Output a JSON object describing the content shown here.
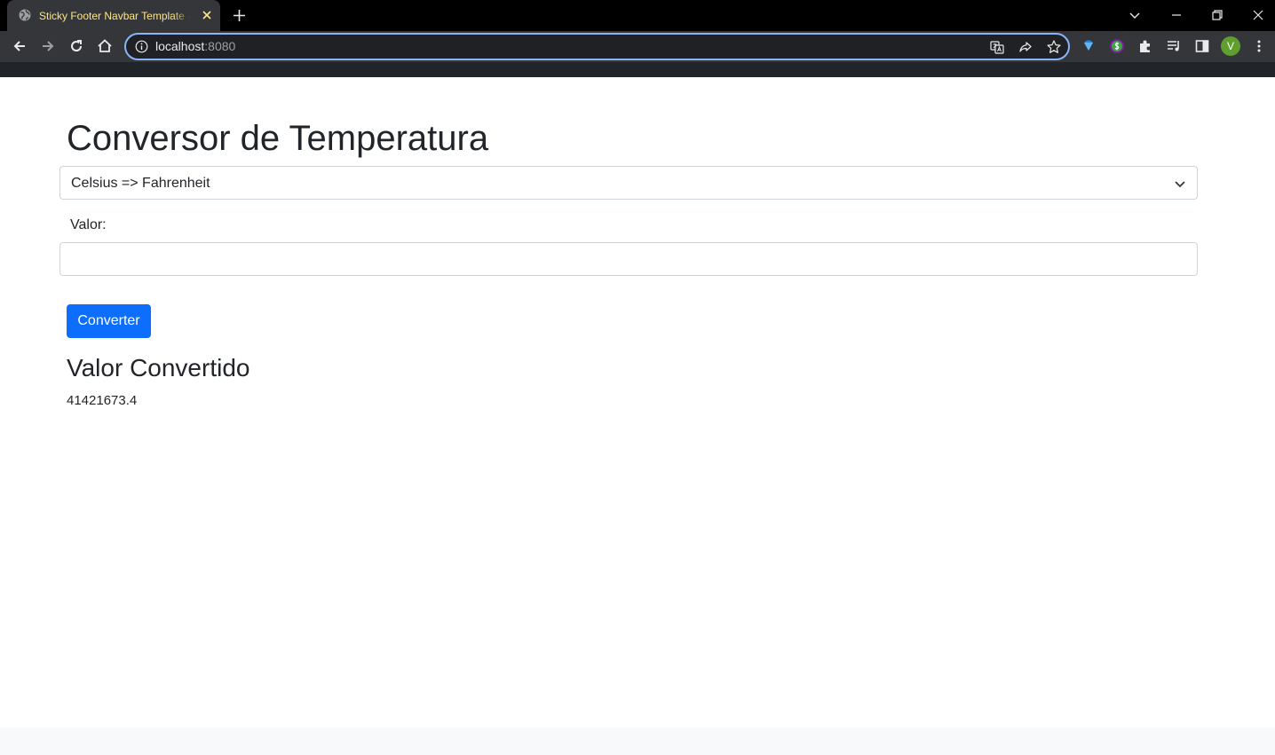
{
  "browser": {
    "tab": {
      "title": "Sticky Footer Navbar Template · Bootstrap"
    },
    "address_bar": {
      "host": "localhost",
      "port": ":8080"
    },
    "profile_initial": "V",
    "colors": {
      "tab_title": "#fde68a",
      "omnibox_focus": "#8ab4f8",
      "profile": "#5f9e2f"
    }
  },
  "page": {
    "title": "Conversor de Temperatura",
    "conversion_select": {
      "selected": "Celsius => Fahrenheit"
    },
    "value_label": "Valor:",
    "value_input": {
      "value": "",
      "placeholder": ""
    },
    "convert_button_label": "Converter",
    "result_heading": "Valor Convertido",
    "result_value": "41421673.4",
    "colors": {
      "primary": "#0d6efd",
      "navbar": "#212529",
      "footer": "#f8f9fa"
    }
  }
}
